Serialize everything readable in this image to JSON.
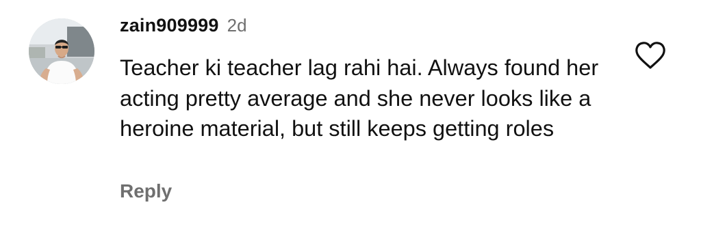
{
  "comment": {
    "username": "zain909999",
    "timestamp": "2d",
    "text": "Teacher ki teacher lag rahi hai. Always found her acting pretty average and she never looks like a heroine material, but still keeps getting roles",
    "reply_label": "Reply"
  },
  "icons": {
    "like": "heart-outline-icon",
    "avatar": "profile-avatar"
  },
  "colors": {
    "text_primary": "#111111",
    "text_secondary": "#6f6f6f",
    "background": "#ffffff"
  }
}
